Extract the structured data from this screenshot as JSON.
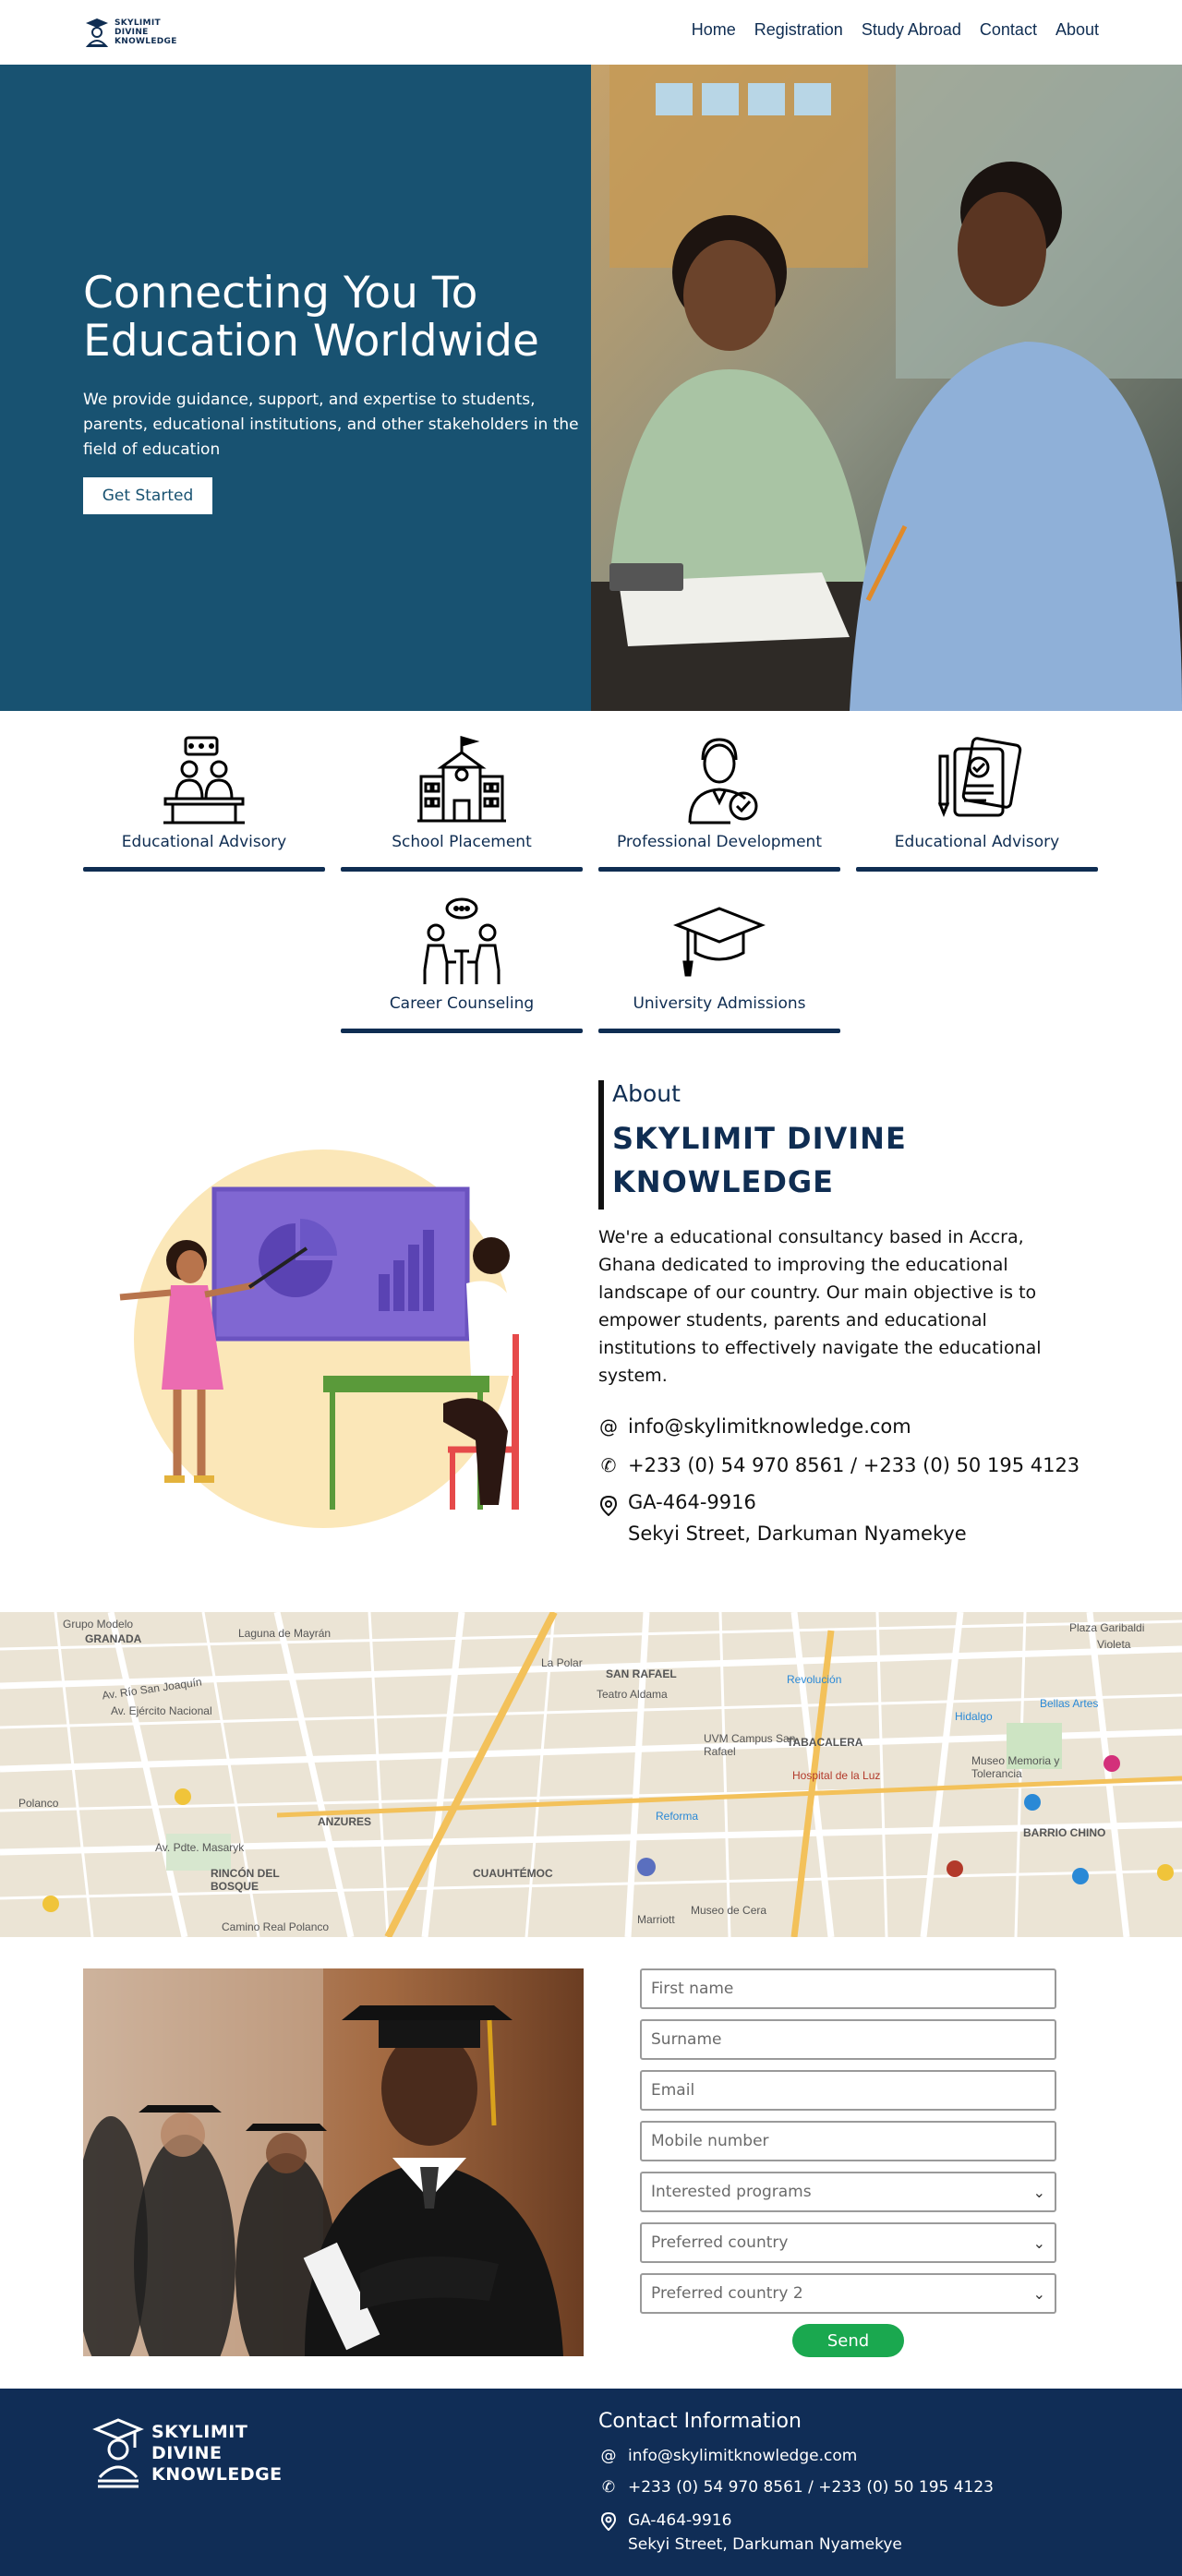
{
  "brand": {
    "name_lines": [
      "SKYLIMIT",
      "DIVINE",
      "KNOWLEDGE"
    ]
  },
  "nav": {
    "items": [
      "Home",
      "Registration",
      "Study Abroad",
      "Contact",
      "About"
    ]
  },
  "hero": {
    "title": "Connecting You To Education Worldwide",
    "subtitle": "We provide guidance, support, and expertise to students, parents, educational institutions, and other stakeholders in the field of education",
    "cta": "Get Started"
  },
  "services": [
    {
      "label": "Educational Advisory",
      "icon": "classroom-icon"
    },
    {
      "label": "School Placement",
      "icon": "school-building-icon"
    },
    {
      "label": "Professional Development",
      "icon": "professional-badge-icon"
    },
    {
      "label": "Educational Advisory",
      "icon": "clipboard-check-icon"
    },
    {
      "label": "Career Counseling",
      "icon": "counseling-icon"
    },
    {
      "label": "University Admissions",
      "icon": "graduation-cap-icon"
    }
  ],
  "about": {
    "kicker": "About",
    "title": "SKYLIMIT DIVINE KNOWLEDGE",
    "description": "We're a educational consultancy based in Accra, Ghana dedicated to improving the educational landscape of our country. Our main objective is to empower students, parents and educational institutions to effectively navigate the educational system.",
    "email": "info@skylimitknowledge.com",
    "phone": "+233 (0) 54 970 8561 / +233 (0) 50 195 4123",
    "address_line1": "GA-464-9916",
    "address_line2": "Sekyi Street, Darkuman Nyamekye"
  },
  "map": {
    "labels": [
      "Grupo Modelo",
      "GRANADA",
      "Laguna de Mayrán",
      "Av. Río San Joaquín",
      "Av. Ejército Nacional",
      "Polanco",
      "ANZURES",
      "RINCÓN DEL BOSQUE",
      "CUAUHTÉMOC",
      "SAN RAFAEL",
      "Teatro Aldama",
      "UVM Campus San Rafael",
      "TABACALERA",
      "Hospital de la Luz",
      "Museo Memoria y Tolerancia",
      "BARRIO CHINO",
      "Plaza Garibaldi",
      "Violeta",
      "Revolución",
      "Hidalgo",
      "Bellas Artes",
      "Reforma",
      "Marriott",
      "Museo de Cera",
      "Camino Real Polanco",
      "La Polar",
      "Av. Pdte. Masaryk"
    ]
  },
  "form": {
    "first_name": "First name",
    "surname": "Surname",
    "email": "Email",
    "mobile": "Mobile number",
    "programs": "Interested programs",
    "country1": "Preferred country",
    "country2": "Preferred country 2",
    "send": "Send"
  },
  "footer": {
    "title": "Contact Information",
    "email": "info@skylimitknowledge.com",
    "phone": "+233 (0) 54 970 8561 / +233 (0) 50 195 4123",
    "address_line1": "GA-464-9916",
    "address_line2": "Sekyi Street, Darkuman Nyamekye"
  },
  "colors": {
    "hero_bg": "#185271",
    "navy": "#0f2d52",
    "footer_bg": "#102d56",
    "send": "#1aa84f"
  }
}
